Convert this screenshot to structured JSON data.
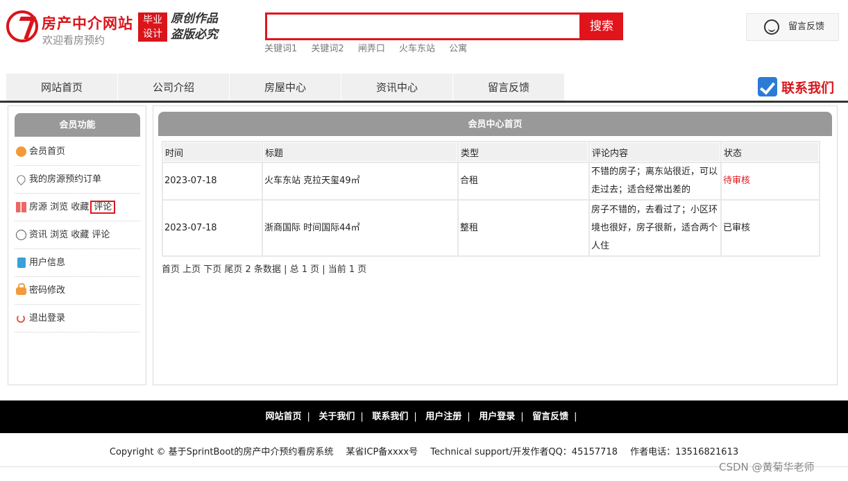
{
  "header": {
    "site_title": "房产中介网站",
    "site_subtitle": "欢迎看房预约",
    "badge_line1": "毕业",
    "badge_line2": "设计",
    "badge_slogan1": "原创作品",
    "badge_slogan2": "盗版必究",
    "search": {
      "placeholder": "",
      "button": "搜索"
    },
    "hot_keywords": [
      "关键词1",
      "关键词2",
      "闸弄口",
      "火车东站",
      "公寓"
    ],
    "feedback": "留言反馈",
    "contact_us": "联系我们"
  },
  "nav": [
    "网站首页",
    "公司介绍",
    "房屋中心",
    "资讯中心",
    "留言反馈"
  ],
  "sidebar": {
    "title": "会员功能",
    "items": [
      {
        "icon": "home-icon",
        "label": "会员首页"
      },
      {
        "icon": "heart-icon",
        "label": "我的房源预约订单"
      },
      {
        "icon": "grid-icon",
        "label": "房源 浏览 收藏",
        "extra": "评论"
      },
      {
        "icon": "clock-icon",
        "label": "资讯 浏览 收藏 评论"
      },
      {
        "icon": "user-info-icon",
        "label": "用户信息"
      },
      {
        "icon": "lock-icon",
        "label": "密码修改"
      },
      {
        "icon": "power-icon",
        "label": "退出登录"
      }
    ]
  },
  "main": {
    "title": "会员中心首页",
    "table": {
      "headers": [
        "时间",
        "标题",
        "类型",
        "评论内容",
        "状态"
      ],
      "rows": [
        {
          "time": "2023-07-18",
          "title": "火车东站 克拉天玺49㎡",
          "type": "合租",
          "comment": "不错的房子；离东站很近，可以走过去；适合经常出差的",
          "status": "待审核"
        },
        {
          "time": "2023-07-18",
          "title": "浙商国际 时间国际44㎡",
          "type": "整租",
          "comment": "房子不错的，去看过了；小区环境也很好，房子很新，适合两个人住",
          "status": "已审核"
        }
      ]
    },
    "pager": "首页 上页 下页 尾页 2 条数据 | 总 1 页 | 当前 1 页"
  },
  "footer": {
    "links": [
      "网站首页",
      "关于我们",
      "联系我们",
      "用户注册",
      "用户登录",
      "留言反馈"
    ],
    "copyright": "Copyright © 基于SprintBoot的房产中介预约看房系统",
    "icp": "某省ICP备xxxx号",
    "support": "Technical support/开发作者QQ：45157718",
    "phone": "作者电话：13516821613"
  },
  "watermark": "CSDN @黄菊华老师",
  "colors": {
    "accent": "#e1141b",
    "header_gray": "#999999",
    "footer_bg": "#000000"
  }
}
